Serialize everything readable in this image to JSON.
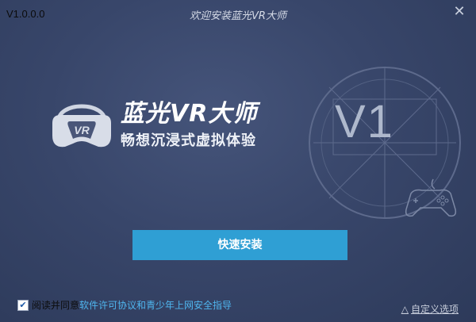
{
  "window": {
    "version": "V1.0.0.0",
    "title": "欢迎安装蓝光VR大师",
    "close_glyph": "✕"
  },
  "brand": {
    "name": "蓝光VR大师",
    "slogan": "畅想沉浸式虚拟体验",
    "emblem_text": "V1",
    "logo_mark": "VR"
  },
  "actions": {
    "install_label": "快速安装",
    "custom_options": "自定义选项",
    "custom_arrow": "△"
  },
  "agreement": {
    "checked": true,
    "check_glyph": "✔",
    "prefix": "阅读并同意",
    "link": "软件许可协议和青少年上网安全指导"
  },
  "colors": {
    "background": "#38466a",
    "accent": "#2f9fd4",
    "link": "#4fb6ef"
  }
}
